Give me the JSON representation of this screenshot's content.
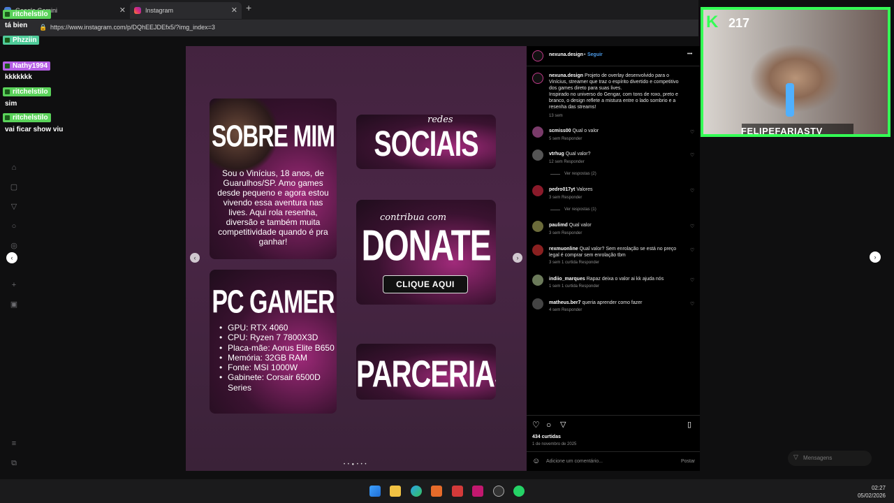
{
  "browser": {
    "tabs": [
      {
        "label": "Google Gemini"
      },
      {
        "label": "Instagram"
      }
    ],
    "new_tab": "+",
    "url": "https://www.instagram.com/p/DQhEEJDEfx5/?img_index=3"
  },
  "chat": {
    "messages": [
      {
        "user": "ritchelstilo",
        "text": "tá bien"
      },
      {
        "user": "Phzziin",
        "text": ""
      },
      {
        "user": "Nathy1994",
        "text": "kkkkkkk"
      },
      {
        "user": "ritchelstilo",
        "text": "sim"
      },
      {
        "user": "ritchelstilo",
        "text": "vai ficar show viu"
      }
    ],
    "colors": {
      "ritchelstilo": "#5ad35a",
      "Phzziin": "#4fcc9a",
      "Nathy1994": "#b65fe6"
    }
  },
  "post": {
    "about_card": {
      "title": "SOBRE MIM",
      "text": "Sou o Vinícius, 18 anos, de Guarulhos/SP. Amo games desde pequeno e agora estou vivendo essa aventura nas lives. Aqui rola resenha, diversão e também muita competitividade quando é pra ganhar!"
    },
    "social_card": {
      "script": "redes",
      "title": "SOCIAIS"
    },
    "donate_card": {
      "script": "contribua com",
      "title": "DONATE",
      "button": "CLIQUE AQUI"
    },
    "pc_card": {
      "title": "PC GAMER",
      "specs": [
        "GPU: RTX 4060",
        "CPU: Ryzen 7 7800X3D",
        "Placa-mãe: Aorus Elite B650",
        "Memória: 32GB RAM",
        "Fonte: MSI 1000W",
        "Gabinete: Corsair 6500D Series"
      ]
    },
    "partners_card": {
      "title": "PARCERIAS"
    },
    "carousel_dots": "• • ● • • •"
  },
  "panel": {
    "author": "nexuna.design",
    "follow": "Seguir",
    "more": "•••",
    "caption_user": "nexuna.design",
    "caption": "Projeto de overlay desenvolvido para o Vinícius, streamer que traz o espírito divertido e competitivo dos games direto para suas lives.",
    "caption2": "Inspirado no universo do Gengar, com tons de roxo, preto e branco, o design reflete a mistura entre o lado sombrio e a resenha das streams!",
    "caption_time": "13 sem",
    "comments": [
      {
        "user": "scmiss00",
        "text": "Qual o valor",
        "meta": "5 sem   Responder",
        "color": "#7a3b6a"
      },
      {
        "user": "vtrhug",
        "text": "Qual valor?",
        "meta": "12 sem   Responder",
        "color": "#555"
      },
      {
        "user": "pedro017yt",
        "text": "Valores",
        "meta": "3 sem   Responder",
        "color": "#8a1a2a"
      },
      {
        "user": "paulimd",
        "text": "Qual valor",
        "meta": "3 sem   Responder",
        "color": "#6b6b3a"
      },
      {
        "user": "rexmuonline",
        "text": "Qual valor? Sem enrolação se está no preço legal é comprar sem enrolação tbm",
        "meta": "3 sem   1 curtida   Responder",
        "color": "#8a2020"
      },
      {
        "user": "indiio_marques",
        "text": "Rapaz deixa o valor ai kk ajuda nós",
        "meta": "1 sem   1 curtida   Responder",
        "color": "#6b7a5a"
      },
      {
        "user": "matheus.ber7",
        "text": "queria aprender como fazer",
        "meta": "4 sem   Responder",
        "color": "#444"
      }
    ],
    "replies": [
      "Ver respostas (2)",
      "Ver respostas (1)"
    ],
    "likes": "434 curtidas",
    "date": "1 de novembro de 2025",
    "comment_placeholder": "Adicione um comentário...",
    "post_button": "Postar"
  },
  "messages_label": "Mensagens",
  "webcam": {
    "points": "217",
    "streamer": "FELIPEFARIASTV"
  },
  "taskbar": {
    "time": "02:27",
    "date": "05/02/2026"
  }
}
